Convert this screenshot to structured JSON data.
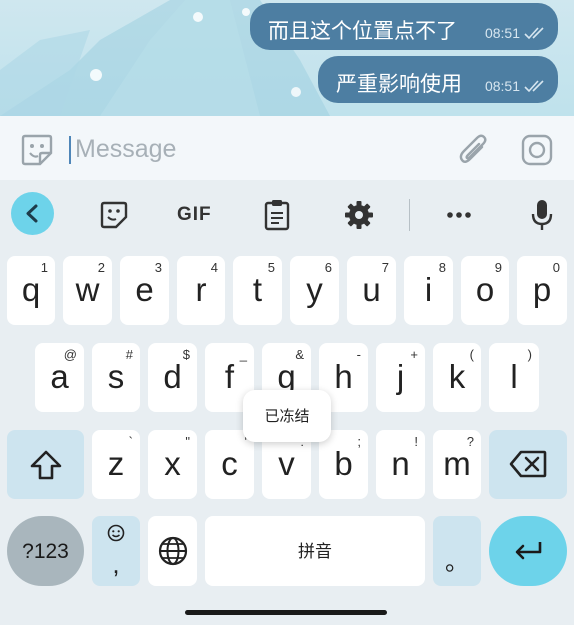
{
  "chat": {
    "messages": [
      {
        "text": "而且这个位置点不了",
        "time": "08:51"
      },
      {
        "text": "严重影响使用",
        "time": "08:51"
      }
    ]
  },
  "input": {
    "placeholder": "Message"
  },
  "toolbar": {
    "gif_label": "GIF"
  },
  "keyboard": {
    "row1": [
      {
        "key": "q",
        "hint": "1"
      },
      {
        "key": "w",
        "hint": "2"
      },
      {
        "key": "e",
        "hint": "3"
      },
      {
        "key": "r",
        "hint": "4"
      },
      {
        "key": "t",
        "hint": "5"
      },
      {
        "key": "y",
        "hint": "6"
      },
      {
        "key": "u",
        "hint": "7"
      },
      {
        "key": "i",
        "hint": "8"
      },
      {
        "key": "o",
        "hint": "9"
      },
      {
        "key": "p",
        "hint": "0"
      }
    ],
    "row2": [
      {
        "key": "a",
        "hint": "@"
      },
      {
        "key": "s",
        "hint": "#"
      },
      {
        "key": "d",
        "hint": "$"
      },
      {
        "key": "f",
        "hint": "_"
      },
      {
        "key": "g",
        "hint": "&"
      },
      {
        "key": "h",
        "hint": "-"
      },
      {
        "key": "j",
        "hint": "+"
      },
      {
        "key": "k",
        "hint": "("
      },
      {
        "key": "l",
        "hint": ")"
      }
    ],
    "row3": [
      {
        "key": "z",
        "hint": "`"
      },
      {
        "key": "x",
        "hint": "\""
      },
      {
        "key": "c",
        "hint": "'"
      },
      {
        "key": "v",
        "hint": ":"
      },
      {
        "key": "b",
        "hint": ";"
      },
      {
        "key": "n",
        "hint": "!"
      },
      {
        "key": "m",
        "hint": "?"
      }
    ],
    "numbers_label": "?123",
    "emoji_comma": ",",
    "space_label": "拼音",
    "period_label": "。",
    "popup_label": "已冻结"
  },
  "colors": {
    "bubble": "#4d7ea2",
    "accent": "#6dd3ea",
    "chat_bg": "#c4e4ee"
  }
}
